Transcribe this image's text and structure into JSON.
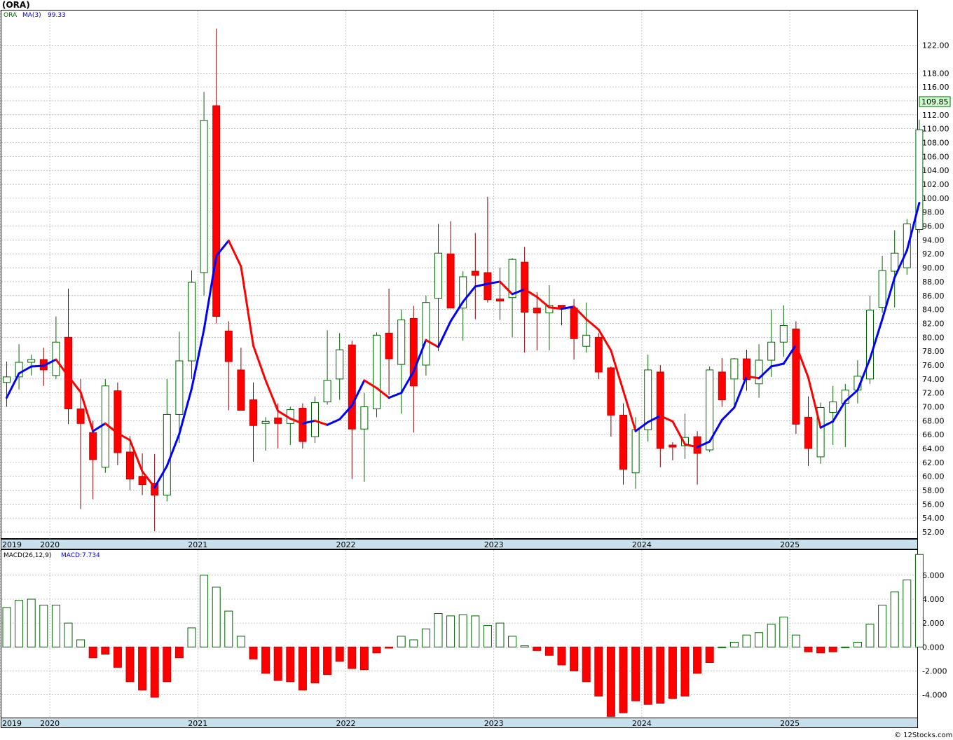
{
  "title": "(ORA)",
  "watermark": "© 12Stocks.com",
  "colors": {
    "up_candle": "#006600",
    "down_candle": "#ff0000",
    "ma_up": "#0000ff",
    "ma_down": "#ff0000",
    "grid": "#a0a0a0",
    "axis_band": "#c8e0ec",
    "price_box": "#ccffcc"
  },
  "legend": {
    "symbol": "ORA",
    "ma_label": "MA(3)",
    "ma_value": "99.33",
    "macd_label": "MACD(26,12,9)",
    "macd_value_label": "MACD:7.734"
  },
  "last_price": "109.85",
  "chart_data": [
    {
      "type": "candlestick",
      "name": "price",
      "ylim": [
        51.0,
        127.0
      ],
      "y_ticks": [
        "52.00",
        "54.00",
        "56.00",
        "58.00",
        "60.00",
        "62.00",
        "64.00",
        "66.00",
        "68.00",
        "70.00",
        "72.00",
        "74.00",
        "76.00",
        "78.00",
        "80.00",
        "82.00",
        "84.00",
        "86.00",
        "88.00",
        "90.00",
        "92.00",
        "94.00",
        "96.00",
        "98.00",
        "100.00",
        "102.00",
        "104.00",
        "106.00",
        "108.00",
        "110.00",
        "112.00",
        "114.00",
        "116.00",
        "118.00",
        "122.00"
      ],
      "x_labels": [
        "2019",
        "2020",
        "2021",
        "2022",
        "2023",
        "2024",
        "2025"
      ],
      "x_label_index": [
        -0.5,
        3.5,
        15.5,
        27.5,
        39.5,
        51.5,
        63.5
      ],
      "ohlc": [
        [
          73.5,
          76.5,
          70.0,
          74.3
        ],
        [
          74.3,
          79.0,
          72.5,
          76.4
        ],
        [
          76.4,
          77.5,
          74.5,
          76.8
        ],
        [
          76.8,
          78.5,
          73.0,
          75.3
        ],
        [
          74.5,
          83.0,
          74.0,
          79.3
        ],
        [
          80.0,
          87.0,
          67.5,
          69.7
        ],
        [
          69.7,
          74.0,
          55.3,
          67.6
        ],
        [
          66.3,
          68.0,
          56.7,
          62.4
        ],
        [
          61.3,
          74.0,
          60.5,
          73.0
        ],
        [
          72.3,
          73.5,
          61.6,
          63.4
        ],
        [
          63.5,
          65.8,
          58.0,
          59.6
        ],
        [
          60.0,
          63.3,
          57.3,
          58.8
        ],
        [
          59.0,
          63.2,
          52.1,
          57.3
        ],
        [
          57.3,
          74.0,
          56.4,
          68.9
        ],
        [
          68.9,
          80.8,
          64.8,
          76.6
        ],
        [
          76.6,
          89.6,
          74.0,
          87.9
        ],
        [
          89.3,
          115.3,
          86.0,
          111.2
        ],
        [
          113.3,
          124.4,
          82.0,
          83.0
        ],
        [
          80.9,
          82.3,
          69.5,
          76.5
        ],
        [
          75.3,
          78.5,
          69.8,
          69.5
        ],
        [
          71.0,
          73.5,
          62.1,
          67.3
        ],
        [
          67.6,
          68.5,
          63.7,
          67.9
        ],
        [
          68.4,
          70.5,
          64.0,
          67.6
        ],
        [
          67.6,
          70.0,
          64.5,
          69.6
        ],
        [
          69.8,
          70.5,
          64.0,
          65.0
        ],
        [
          65.7,
          71.5,
          64.8,
          70.6
        ],
        [
          70.7,
          81.0,
          70.3,
          73.8
        ],
        [
          74.0,
          80.6,
          71.0,
          78.2
        ],
        [
          78.9,
          79.5,
          59.6,
          66.8
        ],
        [
          66.8,
          72.0,
          59.2,
          70.0
        ],
        [
          69.7,
          80.7,
          68.5,
          80.3
        ],
        [
          80.6,
          87.0,
          71.7,
          76.9
        ],
        [
          76.1,
          84.0,
          69.0,
          82.5
        ],
        [
          82.7,
          84.5,
          66.3,
          73.0
        ],
        [
          76.0,
          86.0,
          74.5,
          85.0
        ],
        [
          85.6,
          96.3,
          78.0,
          92.1
        ],
        [
          92.0,
          96.7,
          84.8,
          84.2
        ],
        [
          84.2,
          89.5,
          79.5,
          88.7
        ],
        [
          89.5,
          95.0,
          82.6,
          88.9
        ],
        [
          89.3,
          100.2,
          85.0,
          85.4
        ],
        [
          85.5,
          90.0,
          82.5,
          85.2
        ],
        [
          85.7,
          91.4,
          80.0,
          91.2
        ],
        [
          90.8,
          93.0,
          77.8,
          83.6
        ],
        [
          84.2,
          86.5,
          78.1,
          83.5
        ],
        [
          83.5,
          87.5,
          78.1,
          84.6
        ],
        [
          84.6,
          84.6,
          81.7,
          84.2
        ],
        [
          84.2,
          85.5,
          76.8,
          79.8
        ],
        [
          78.7,
          85.0,
          77.8,
          80.3
        ],
        [
          80.0,
          80.6,
          74.0,
          75.0
        ],
        [
          75.6,
          75.8,
          65.7,
          68.8
        ],
        [
          68.8,
          70.5,
          58.8,
          61.0
        ],
        [
          60.5,
          68.5,
          58.2,
          66.7
        ],
        [
          66.7,
          77.5,
          65.0,
          75.3
        ],
        [
          75.0,
          76.0,
          61.3,
          64.0
        ],
        [
          64.5,
          64.9,
          62.3,
          64.2
        ],
        [
          64.4,
          69.0,
          62.5,
          65.6
        ],
        [
          65.7,
          66.5,
          58.8,
          63.3
        ],
        [
          63.8,
          75.8,
          63.5,
          75.3
        ],
        [
          75.0,
          77.0,
          70.0,
          71.0
        ],
        [
          74.0,
          77.0,
          70.0,
          76.9
        ],
        [
          76.9,
          78.2,
          72.3,
          73.9
        ],
        [
          73.3,
          79.0,
          71.3,
          76.7
        ],
        [
          76.7,
          84.0,
          74.3,
          79.3
        ],
        [
          79.3,
          84.6,
          77.2,
          81.7
        ],
        [
          81.2,
          82.3,
          66.1,
          67.5
        ],
        [
          68.5,
          71.5,
          61.5,
          64.0
        ],
        [
          62.8,
          70.6,
          61.8,
          69.9
        ],
        [
          69.2,
          73.0,
          64.5,
          70.7
        ],
        [
          70.5,
          73.3,
          64.2,
          72.4
        ],
        [
          72.4,
          76.7,
          70.5,
          74.4
        ],
        [
          74.0,
          86.0,
          73.3,
          83.9
        ],
        [
          84.3,
          91.7,
          83.5,
          89.6
        ],
        [
          89.5,
          95.4,
          84.3,
          92.1
        ],
        [
          90.0,
          97.0,
          89.0,
          96.3
        ],
        [
          95.5,
          111.3,
          95.0,
          109.85
        ]
      ],
      "ma3": [
        71.3,
        74.8,
        75.8,
        75.9,
        76.8,
        74.4,
        72.1,
        66.5,
        67.6,
        66.2,
        65.2,
        60.7,
        58.4,
        61.5,
        66.1,
        72.6,
        81.1,
        91.7,
        93.9,
        90.2,
        78.8,
        73.8,
        69.4,
        68.3,
        67.6,
        68.0,
        67.4,
        68.2,
        70.2,
        73.8,
        72.7,
        71.3,
        72.0,
        75.1,
        79.6,
        78.6,
        82.3,
        85.1,
        87.3,
        87.7,
        88.0,
        86.2,
        86.9,
        85.8,
        84.3,
        84.1,
        84.4,
        82.6,
        81.1,
        78.1,
        72.3,
        66.5,
        67.8,
        68.7,
        67.9,
        64.6,
        64.2,
        65.0,
        68.1,
        69.9,
        74.4,
        74.1,
        75.8,
        76.2,
        78.9,
        74.2,
        67.0,
        67.9,
        70.8,
        72.4,
        76.9,
        82.6,
        88.6,
        92.5,
        99.33
      ]
    },
    {
      "type": "bar",
      "name": "MACD(26,12,9)",
      "ylim": [
        -5.9,
        8.1
      ],
      "y_ticks": [
        "-4.000",
        "-2.000",
        "0.000",
        "2.000",
        "4.000",
        "6.000"
      ],
      "x_labels": [
        "2019",
        "2020",
        "2021",
        "2022",
        "2023",
        "2024",
        "2025"
      ],
      "values": [
        3.3,
        3.9,
        4.0,
        3.5,
        3.5,
        2.0,
        0.6,
        -0.9,
        -0.6,
        -1.7,
        -2.9,
        -3.6,
        -4.2,
        -2.9,
        -0.9,
        1.6,
        6.0,
        5.0,
        3.0,
        0.9,
        -1.0,
        -2.2,
        -2.8,
        -2.9,
        -3.6,
        -3.0,
        -2.3,
        -1.2,
        -1.8,
        -1.9,
        -0.5,
        -0.1,
        0.9,
        0.6,
        1.5,
        2.8,
        2.6,
        2.7,
        2.6,
        1.8,
        2.0,
        0.9,
        0.1,
        -0.3,
        -0.7,
        -1.5,
        -2.0,
        -2.9,
        -4.1,
        -5.8,
        -5.5,
        -4.5,
        -4.8,
        -4.7,
        -4.3,
        -4.1,
        -2.2,
        -1.3,
        0.0,
        0.4,
        1.0,
        1.2,
        1.9,
        2.5,
        1.0,
        -0.4,
        -0.5,
        -0.4,
        0.0,
        0.4,
        1.9,
        3.5,
        4.6,
        5.6,
        7.734
      ]
    }
  ]
}
